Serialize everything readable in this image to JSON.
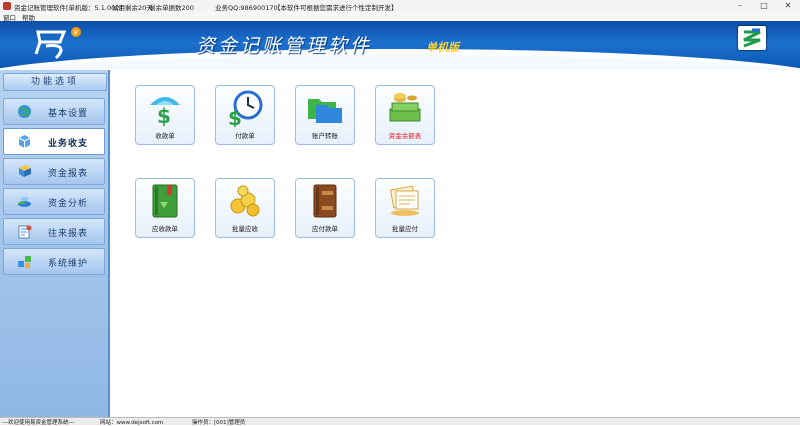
{
  "window": {
    "title": "资金记账管理软件[单机版：5.1.002]",
    "trial": "试用剩余20天",
    "trial_count": "剩余单据数200",
    "qq": "业务QQ:986900170",
    "notice": "【本软件可根据您需求进行个性定制开发】"
  },
  "menu": [
    "窗口",
    "帮助"
  ],
  "banner": {
    "title": "资金记账管理软件",
    "subtitle": "单机版"
  },
  "sidebar": {
    "header": "功能选项",
    "items": [
      {
        "label": "基本设置",
        "icon": "globe-icon"
      },
      {
        "label": "业务收支",
        "icon": "cube-icon"
      },
      {
        "label": "资金报表",
        "icon": "table-icon"
      },
      {
        "label": "资金分析",
        "icon": "chart-icon"
      },
      {
        "label": "往来报表",
        "icon": "report-icon"
      },
      {
        "label": "系统维护",
        "icon": "gears-icon"
      }
    ]
  },
  "tiles": [
    {
      "label": "收款单",
      "icon": "dollar-umbrella-icon"
    },
    {
      "label": "付款单",
      "icon": "dollar-clock-icon"
    },
    {
      "label": "账户转账",
      "icon": "folders-icon"
    },
    {
      "label": "资金余额表",
      "icon": "money-stack-icon",
      "color": "#d42020"
    },
    {
      "label": "应收款单",
      "icon": "green-book-icon"
    },
    {
      "label": "批量应收",
      "icon": "coins-icon"
    },
    {
      "label": "应付款单",
      "icon": "brown-book-icon"
    },
    {
      "label": "批量应付",
      "icon": "documents-icon"
    }
  ],
  "status": {
    "welcome": "---欢迎使用易资金管理系统---",
    "website": "网站：www.dejsoft.com",
    "operator": "操作员：[001]管理员"
  }
}
